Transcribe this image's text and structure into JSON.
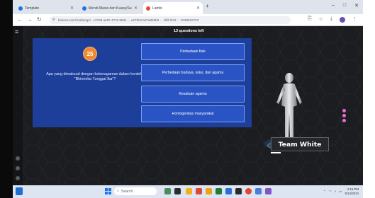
{
  "browser": {
    "tabs": [
      {
        "label": "Template",
        "favicon_color": "#1a73e8",
        "active": false
      },
      {
        "label": "Mendi Masis dan Kuasy/Surfi",
        "favicon_color": "#1a73e8",
        "active": false
      },
      {
        "label": "Lambi",
        "favicon_color": "#e5493a",
        "active": true
      }
    ],
    "url": "kahoot.com/challenge/...c2759 a497 47c6 98d1 ... e27b0c/ad7a8b5b8 ... 4ffd 9f4d ... 2039822722",
    "new_tab_glyph": "+",
    "window_controls": [
      "–",
      "□",
      "✕"
    ]
  },
  "game": {
    "questions_left": "13 questions left",
    "timer_value": "25",
    "question": "Apa yang dimaksud dengan keberagaman dalam konteks \"Bhinneka Tunggal Ika\"?",
    "answers": [
      "Perbedaan fisik",
      "Perbedaan budaya, suku, dan agama",
      "Kesatuan agama",
      "Homogenitas masyarakat"
    ],
    "team_name": "Team White",
    "accent": "#1d3f9a",
    "answer_color": "#2a54c4",
    "timer_color": "#f08a30"
  },
  "taskbar": {
    "search_placeholder": "Search",
    "clock_time": "4:16 PM",
    "clock_date": "5/14/2024"
  }
}
